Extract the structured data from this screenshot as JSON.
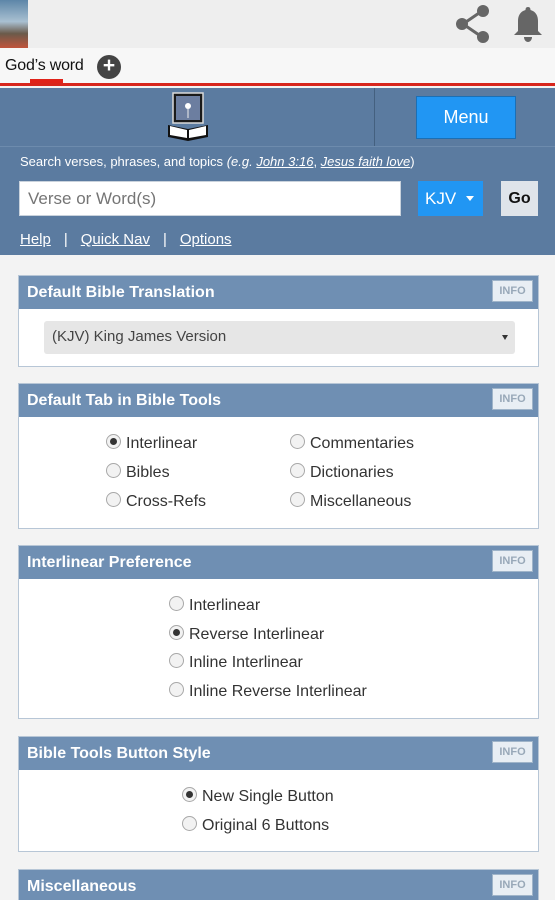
{
  "tab": {
    "label": "God’s word"
  },
  "icons": {
    "share": "share-icon",
    "notifications": "bell-icon",
    "add_tab": "plus-circle-icon",
    "logo": "bible-logo-icon"
  },
  "header": {
    "menu_label": "Menu",
    "hint_prefix": "Search verses, phrases, and topics",
    "hint_eg": "(e.g.",
    "hint_example1": "John 3:16",
    "hint_example2": "Jesus faith love",
    "hint_close": ")",
    "search_placeholder": "Verse or Word(s)",
    "version": "KJV",
    "go_label": "Go",
    "links": {
      "help": "Help",
      "quick_nav": "Quick Nav",
      "options": "Options",
      "separator": "|"
    }
  },
  "panels": {
    "info_label": "INFO",
    "translation": {
      "title": "Default Bible Translation",
      "selected": "(KJV) King James Version"
    },
    "default_tab": {
      "title": "Default Tab in Bible Tools",
      "options": [
        "Interlinear",
        "Bibles",
        "Cross-Refs",
        "Commentaries",
        "Dictionaries",
        "Miscellaneous"
      ],
      "selected": "Interlinear"
    },
    "interlinear": {
      "title": "Interlinear Preference",
      "options": [
        "Interlinear",
        "Reverse Interlinear",
        "Inline Interlinear",
        "Inline Reverse Interlinear"
      ],
      "selected": "Reverse Interlinear"
    },
    "button_style": {
      "title": "Bible Tools Button Style",
      "options": [
        "New Single Button",
        "Original 6 Buttons"
      ],
      "selected": "New Single Button"
    },
    "misc": {
      "title": "Miscellaneous"
    }
  },
  "colors": {
    "header_blue": "#5b7ba0",
    "panel_head": "#6f8fb3",
    "accent_blue": "#2196f3",
    "tab_red": "#e0231a"
  }
}
